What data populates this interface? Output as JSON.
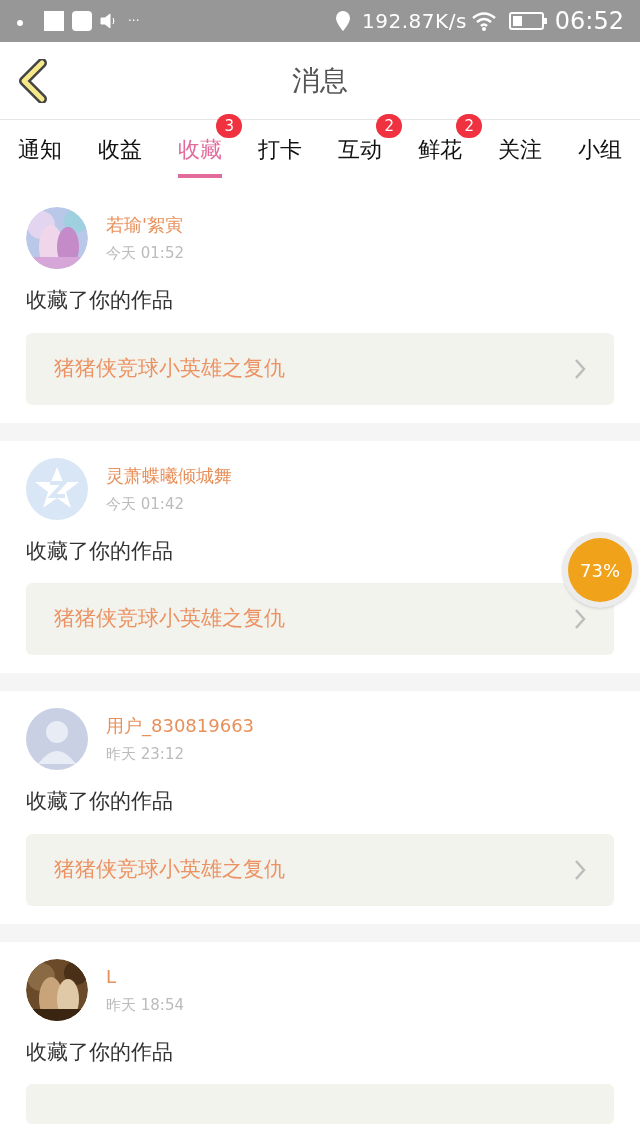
{
  "status_bar": {
    "speed": "192.87K/s",
    "time": "06:52",
    "more": "···"
  },
  "header": {
    "title": "消息"
  },
  "tabs": [
    {
      "label": "通知",
      "selected": false
    },
    {
      "label": "收益",
      "selected": false
    },
    {
      "label": "收藏",
      "selected": true,
      "badge": "3"
    },
    {
      "label": "打卡",
      "selected": false
    },
    {
      "label": "互动",
      "selected": false,
      "badge": "2"
    },
    {
      "label": "鲜花",
      "selected": false,
      "badge": "2"
    },
    {
      "label": "关注",
      "selected": false
    },
    {
      "label": "小组",
      "selected": false
    }
  ],
  "messages": [
    {
      "name": "若瑜'絮寅",
      "time": "今天 01:52",
      "text": "收藏了你的作品",
      "work": "猪猪侠竞球小英雄之复仇"
    },
    {
      "avatar": {
        "kind": "default-logo"
      },
      "name": "灵萧蝶曦倾城舞",
      "time": "今天 01:42",
      "text": "收藏了你的作品",
      "work": "猪猪侠竞球小英雄之复仇"
    },
    {
      "avatar": {
        "kind": "silhouette"
      },
      "name": "用户_830819663",
      "time": "昨天 23:12",
      "text": "收藏了你的作品",
      "work": "猪猪侠竞球小英雄之复仇"
    },
    {
      "name": "L",
      "time": "昨天 18:54",
      "text": "收藏了你的作品"
    }
  ],
  "progress_badge": {
    "label": "73%"
  }
}
